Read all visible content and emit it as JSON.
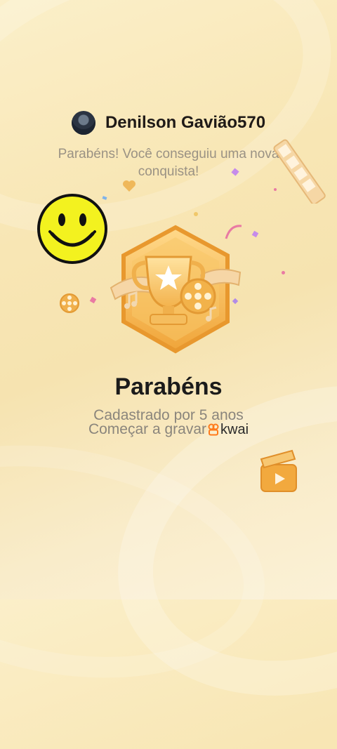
{
  "user": {
    "name": "Denilson Gavião570"
  },
  "subtitle": "Parabéns! Você conseguiu uma nova conquista!",
  "achievement": {
    "title": "Parabéns",
    "detail": "Cadastrado por 5 anos",
    "cta": "Começar a gravar",
    "brand": "kwai"
  },
  "colors": {
    "badge_gold": "#f2b24a",
    "badge_light": "#ffd98a",
    "smiley_yellow": "#f3f21f",
    "brand_orange": "#ff7a1a"
  }
}
